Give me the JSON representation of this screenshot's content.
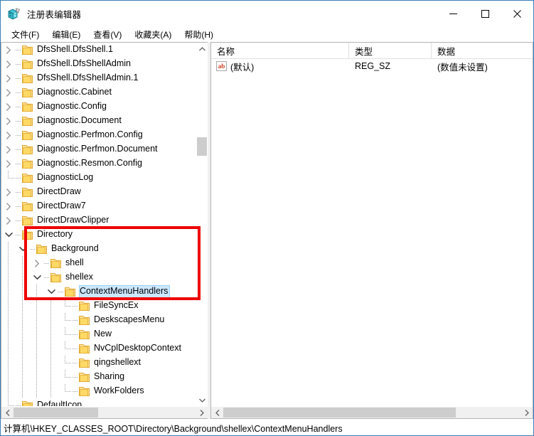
{
  "window": {
    "title": "注册表编辑器",
    "icon": "registry-editor-icon",
    "minimize_label": "─",
    "maximize_label": "□",
    "close_label": "✕"
  },
  "menubar": {
    "items": [
      {
        "label": "文件(F)",
        "name": "menu-file"
      },
      {
        "label": "编辑(E)",
        "name": "menu-edit"
      },
      {
        "label": "查看(V)",
        "name": "menu-view"
      },
      {
        "label": "收藏夹(A)",
        "name": "menu-favorites"
      },
      {
        "label": "帮助(H)",
        "name": "menu-help"
      }
    ]
  },
  "tree": {
    "rows": [
      {
        "label": "DfsShell.DfsShell.1",
        "depth": 1,
        "state": "collapsed",
        "selected": false
      },
      {
        "label": "DfsShell.DfsShellAdmin",
        "depth": 1,
        "state": "collapsed",
        "selected": false
      },
      {
        "label": "DfsShell.DfsShellAdmin.1",
        "depth": 1,
        "state": "collapsed",
        "selected": false
      },
      {
        "label": "Diagnostic.Cabinet",
        "depth": 1,
        "state": "collapsed",
        "selected": false
      },
      {
        "label": "Diagnostic.Config",
        "depth": 1,
        "state": "collapsed",
        "selected": false
      },
      {
        "label": "Diagnostic.Document",
        "depth": 1,
        "state": "collapsed",
        "selected": false
      },
      {
        "label": "Diagnostic.Perfmon.Config",
        "depth": 1,
        "state": "collapsed",
        "selected": false
      },
      {
        "label": "Diagnostic.Perfmon.Document",
        "depth": 1,
        "state": "collapsed",
        "selected": false
      },
      {
        "label": "Diagnostic.Resmon.Config",
        "depth": 1,
        "state": "collapsed",
        "selected": false
      },
      {
        "label": "DiagnosticLog",
        "depth": 1,
        "state": "leaf",
        "selected": false
      },
      {
        "label": "DirectDraw",
        "depth": 1,
        "state": "collapsed",
        "selected": false
      },
      {
        "label": "DirectDraw7",
        "depth": 1,
        "state": "collapsed",
        "selected": false
      },
      {
        "label": "DirectDrawClipper",
        "depth": 1,
        "state": "collapsed",
        "selected": false
      },
      {
        "label": "Directory",
        "depth": 1,
        "state": "expanded",
        "selected": false
      },
      {
        "label": "Background",
        "depth": 2,
        "state": "expanded",
        "selected": false
      },
      {
        "label": "shell",
        "depth": 3,
        "state": "collapsed",
        "selected": false
      },
      {
        "label": "shellex",
        "depth": 3,
        "state": "expanded",
        "selected": false
      },
      {
        "label": "ContextMenuHandlers",
        "depth": 4,
        "state": "expanded",
        "selected": true
      },
      {
        "label": "FileSyncEx",
        "depth": 5,
        "state": "leaf",
        "selected": false
      },
      {
        "label": "DeskscapesMenu",
        "depth": 5,
        "state": "leaf",
        "selected": false
      },
      {
        "label": "New",
        "depth": 5,
        "state": "leaf",
        "selected": false
      },
      {
        "label": "NvCplDesktopContext",
        "depth": 5,
        "state": "leaf",
        "selected": false
      },
      {
        "label": "qingshellext",
        "depth": 5,
        "state": "leaf",
        "selected": false
      },
      {
        "label": "Sharing",
        "depth": 5,
        "state": "leaf",
        "selected": false
      },
      {
        "label": "WorkFolders",
        "depth": 5,
        "state": "leaf",
        "selected": false
      },
      {
        "label": "DefaultIcon",
        "depth": 1,
        "state": "leaf",
        "selected": false
      }
    ]
  },
  "list": {
    "columns": [
      {
        "label": "名称",
        "name": "column-header-name"
      },
      {
        "label": "类型",
        "name": "column-header-type"
      },
      {
        "label": "数据",
        "name": "column-header-data"
      }
    ],
    "rows": [
      {
        "name": "(默认)",
        "type": "REG_SZ",
        "data": "(数值未设置)",
        "icon": "string-value-icon"
      }
    ]
  },
  "statusbar": {
    "path": "计算机\\HKEY_CLASSES_ROOT\\Directory\\Background\\shellex\\ContextMenuHandlers"
  },
  "annotation": {
    "color": "#ee0000",
    "shape": "rectangle",
    "target": "Directory > Background > shellex > ContextMenuHandlers"
  },
  "scrollbars": {
    "tree_vertical": {
      "up_arrow": "∧",
      "down_arrow": "∨"
    },
    "tree_horizontal": {
      "left_arrow": "‹",
      "right_arrow": "›"
    },
    "list_horizontal": {
      "left_arrow": "‹",
      "right_arrow": "›"
    }
  },
  "colors": {
    "selection": "#cce8ff",
    "folder": "#ffd966",
    "annotation": "#ee0000",
    "window_border": "#3a7fba"
  }
}
